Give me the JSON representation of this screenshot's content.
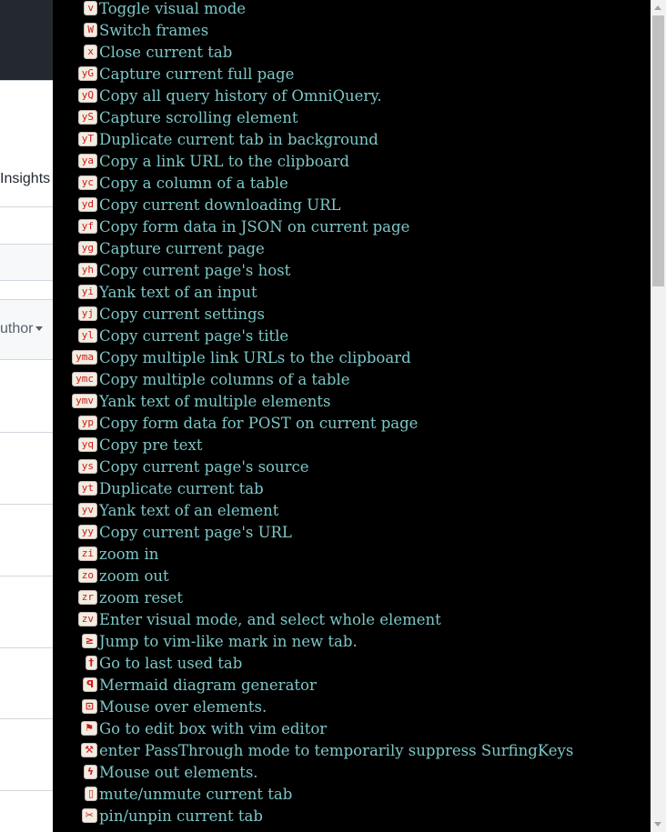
{
  "background_page": {
    "insights_label": "Insights",
    "author_label": "uthor"
  },
  "overlay": {
    "rows": [
      {
        "key": "v",
        "desc": "Toggle visual mode"
      },
      {
        "key": "W",
        "desc": "Switch frames"
      },
      {
        "key": "x",
        "desc": "Close current tab"
      },
      {
        "key": "yG",
        "desc": "Capture current full page"
      },
      {
        "key": "yQ",
        "desc": "Copy all query history of OmniQuery."
      },
      {
        "key": "yS",
        "desc": "Capture scrolling element"
      },
      {
        "key": "yT",
        "desc": "Duplicate current tab in background"
      },
      {
        "key": "ya",
        "desc": "Copy a link URL to the clipboard"
      },
      {
        "key": "yc",
        "desc": "Copy a column of a table"
      },
      {
        "key": "yd",
        "desc": "Copy current downloading URL"
      },
      {
        "key": "yf",
        "desc": "Copy form data in JSON on current page"
      },
      {
        "key": "yg",
        "desc": "Capture current page"
      },
      {
        "key": "yh",
        "desc": "Copy current page's host"
      },
      {
        "key": "yi",
        "desc": "Yank text of an input"
      },
      {
        "key": "yj",
        "desc": "Copy current settings"
      },
      {
        "key": "yl",
        "desc": "Copy current page's title"
      },
      {
        "key": "yma",
        "desc": "Copy multiple link URLs to the clipboard"
      },
      {
        "key": "ymc",
        "desc": "Copy multiple columns of a table"
      },
      {
        "key": "ymv",
        "desc": "Yank text of multiple elements"
      },
      {
        "key": "yp",
        "desc": "Copy form data for POST on current page"
      },
      {
        "key": "yq",
        "desc": "Copy pre text"
      },
      {
        "key": "ys",
        "desc": "Copy current page's source"
      },
      {
        "key": "yt",
        "desc": "Duplicate current tab"
      },
      {
        "key": "yv",
        "desc": "Yank text of an element"
      },
      {
        "key": "yy",
        "desc": "Copy current page's URL"
      },
      {
        "key": "zi",
        "desc": "zoom in"
      },
      {
        "key": "zo",
        "desc": "zoom out"
      },
      {
        "key": "zr",
        "desc": "zoom reset"
      },
      {
        "key": "zv",
        "desc": "Enter visual mode, and select whole element"
      },
      {
        "key": "≥",
        "desc": "Jump to vim-like mark in new tab."
      },
      {
        "key": "†",
        "desc": "Go to last used tab"
      },
      {
        "key": "ꟼ",
        "desc": "Mermaid diagram generator"
      },
      {
        "key": "⊡",
        "desc": "Mouse over elements."
      },
      {
        "key": "⚑",
        "desc": "Go to edit box with vim editor"
      },
      {
        "key": "⚒",
        "desc": "enter PassThrough mode to temporarily suppress SurfingKeys"
      },
      {
        "key": "ϟ",
        "desc": "Mouse out elements."
      },
      {
        "key": "▯",
        "desc": "mute/unmute current tab"
      },
      {
        "key": "✂",
        "desc": "pin/unpin current tab"
      }
    ]
  },
  "colors": {
    "overlay_bg": "#000000",
    "desc_text": "#7ec7c7",
    "kbd_bg": "#f1ede1",
    "kbd_text": "#d01818",
    "header_bg": "#24292f"
  }
}
